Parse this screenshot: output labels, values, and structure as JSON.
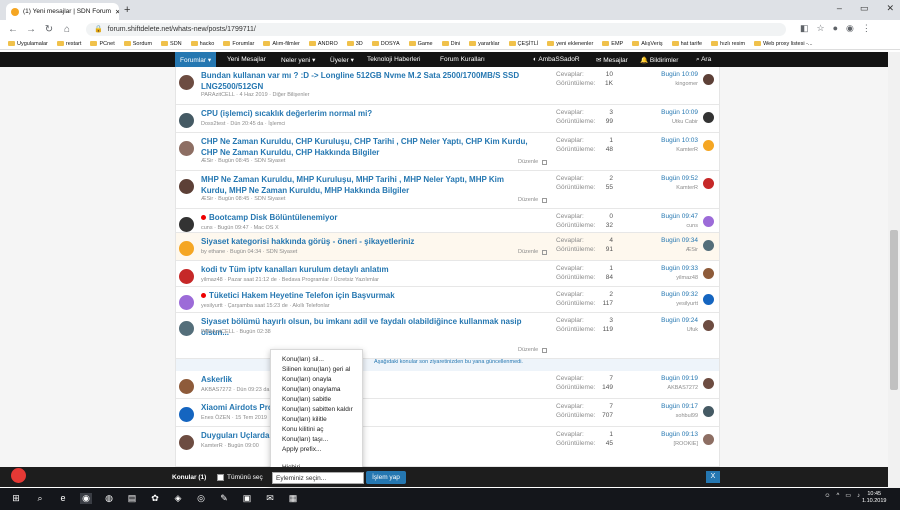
{
  "browser": {
    "tab_title": "(1) Yeni mesajlar | SDN Forum",
    "url": "forum.shiftdelete.net/whats-new/posts/1799711/"
  },
  "bookmarks": [
    "Uygulamalar",
    "restart",
    "PCnet",
    "Sordum",
    "SDN",
    "hacko",
    "Forumlar",
    "Alım-filmler",
    "ANDRO",
    "3D",
    "DOSYA",
    "Game",
    "Dini",
    "yararlılar",
    "ÇEŞİTLİ",
    "yeni eklenenler",
    "EMP",
    "AlışVeriş",
    "hat tarife",
    "hızlı resim",
    "Web proxy listesi -..."
  ],
  "sitenav": {
    "forumlar": "Forumlar",
    "yeni": "Yeni Mesajlar",
    "neler": "Neler yeni",
    "uyeler": "Üyeler",
    "teknoloji": "Teknoloji Haberleri",
    "kurallar": "Forum Kuralları",
    "user": "AmbaSSadoR",
    "mesajlar": "Mesajlar",
    "bildirimler": "Bildirimler",
    "ara": "Ara"
  },
  "threads": [
    {
      "title": "Bundan kullanan var mı ? :D -> Longline 512GB Nvme M.2 Sata 2500/1700MB/S SSD LNG2500/512GN",
      "meta": "PARAzitCELL · 4 Haz 2019 · Diğer Bilişenler",
      "replies": "10",
      "views": "1K",
      "last": "Bugün 10:09",
      "last_user": "kingomer",
      "hl": false,
      "dz": false
    },
    {
      "title": "CPU (işlemci) sıcaklık değerlerim normal mi?",
      "meta": "Doss2test · Dün 20:45 da · İşlemci",
      "replies": "3",
      "views": "99",
      "last": "Bugün 10:09",
      "last_user": "Utku Cabir",
      "hl": false,
      "dz": false
    },
    {
      "title": "CHP Ne Zaman Kuruldu, CHP Kuruluşu, CHP Tarihi , CHP Neler Yaptı, CHP Kim Kurdu, CHP Ne Zaman Kuruldu, CHP Hakkında Bilgiler",
      "meta": "ÆSir · Bugün 08:45 · SDN Siyaset",
      "replies": "1",
      "views": "48",
      "last": "Bugün 10:03",
      "last_user": "KamterR",
      "hl": false,
      "dz": true
    },
    {
      "title": "MHP Ne Zaman Kuruldu, MHP Kuruluşu, MHP Tarihi , MHP Neler Yaptı, MHP Kim Kurdu, MHP Ne Zaman Kuruldu, MHP Hakkında Bilgiler",
      "meta": "ÆSir · Bugün 08:45 · SDN Siyaset",
      "replies": "2",
      "views": "55",
      "last": "Bugün 09:52",
      "last_user": "KamterR",
      "hl": false,
      "dz": true
    },
    {
      "title": "Bootcamp Disk Bölüntülenemiyor",
      "meta": "cuns · Bugün 09:47 · Mac OS X",
      "replies": "0",
      "views": "32",
      "last": "Bugün 09:47",
      "last_user": "cuns",
      "hl": false,
      "dz": false
    },
    {
      "title": "Siyaset kategorisi hakkında görüş - öneri - şikayetleriniz",
      "meta": "by ethane · Bugün 04:34 · SDN Siyaset",
      "replies": "4",
      "views": "91",
      "last": "Bugün 09:34",
      "last_user": "ÆSir",
      "hl": true,
      "dz": true
    },
    {
      "title": "kodi tv Tüm iptv kanalları kurulum detaylı anlatım",
      "meta": "yilmaz48 · Pazar saat 21:12 de · Bedava Programlar / Ücretsiz Yazılımlar",
      "replies": "1",
      "views": "84",
      "last": "Bugün 09:33",
      "last_user": "yilmaz48",
      "hl": false,
      "dz": false
    },
    {
      "title": "Tüketici Hakem Heyetine Telefon için Başvurmak",
      "meta": "yesilyurtt · Çarşamba saat 15:23 de · Akıllı Telefonlar",
      "replies": "2",
      "views": "117",
      "last": "Bugün 09:32",
      "last_user": "yesilyurtt",
      "hl": false,
      "dz": false
    },
    {
      "title": "Siyaset bölümü hayırlı olsun, bu imkanı adil ve faydalı olabildiğince kullanmak nasip olsun...",
      "meta": "PARAzitCELL · Bugün 02:38",
      "replies": "3",
      "views": "119",
      "last": "Bugün 09:24",
      "last_user": "Ufuk",
      "hl": false,
      "dz": true
    },
    {
      "title": "Askerlik",
      "meta": "AKBAS7272 · Dün 09:23 da",
      "replies": "7",
      "views": "149",
      "last": "Bugün 09:19",
      "last_user": "AKBAS7272",
      "hl": false,
      "dz": false
    },
    {
      "title": "Xiaomi Airdots Pro ... me",
      "meta": "Enes ÖZEN · 15 Tem 2019",
      "replies": "7",
      "views": "707",
      "last": "Bugün 09:17",
      "last_user": "sohbul99",
      "hl": false,
      "dz": false
    },
    {
      "title": "Duyguları Uçlarda ...",
      "meta": "KamterR · Bugün 09:00",
      "replies": "1",
      "views": "45",
      "last": "Bugün 09:13",
      "last_user": "[ROOKIE]",
      "hl": false,
      "dz": false
    }
  ],
  "labels": {
    "cevaplar": "Cevaplar:",
    "goruntuleme": "Görüntüleme:",
    "duzenle": "Düzenle",
    "notice": "Aşağıdaki konular son ziyaretinizden bu yana güncellenmedi."
  },
  "menu": [
    "Konu(ları) sil...",
    "Silinen konu(ları) geri al",
    "Konu(ları) onayla",
    "Konu(ları) onaylama",
    "Konu(ları) sabitle",
    "Konu(ları) sabitten kaldır",
    "Konu(ları) kilitle",
    "Konu kilitini aç",
    "Konu(ları) taşı...",
    "Apply prefix...",
    "Hiçbiri"
  ],
  "actionbar": {
    "label": "Konular (1)",
    "all": "Tümünü seç",
    "select": "Eyleminiz seçin...",
    "go": "İşlem yap",
    "close": "X"
  },
  "clock": {
    "time": "10:45",
    "date": "1.10.2019"
  }
}
